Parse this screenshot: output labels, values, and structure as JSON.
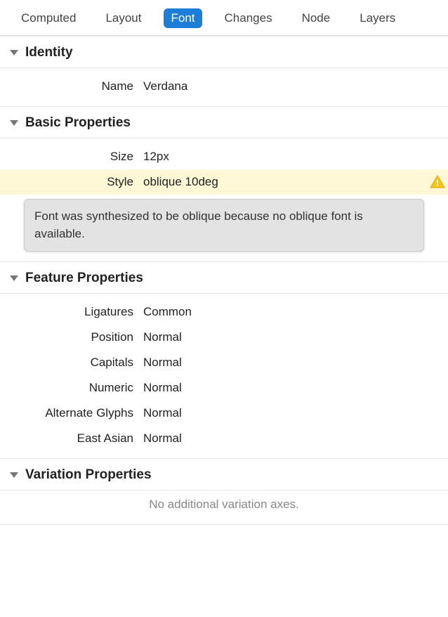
{
  "tabs": {
    "computed": "Computed",
    "layout": "Layout",
    "font": "Font",
    "changes": "Changes",
    "node": "Node",
    "layers": "Layers",
    "active": "font"
  },
  "sections": {
    "identity": {
      "title": "Identity",
      "props": {
        "name": {
          "label": "Name",
          "value": "Verdana"
        }
      }
    },
    "basic": {
      "title": "Basic Properties",
      "props": {
        "size": {
          "label": "Size",
          "value": "12px"
        },
        "style": {
          "label": "Style",
          "value": "oblique 10deg",
          "warning": true
        }
      },
      "warning_message": "Font was synthesized to be oblique because no oblique font is available."
    },
    "feature": {
      "title": "Feature Properties",
      "props": {
        "ligatures": {
          "label": "Ligatures",
          "value": "Common"
        },
        "position": {
          "label": "Position",
          "value": "Normal"
        },
        "capitals": {
          "label": "Capitals",
          "value": "Normal"
        },
        "numeric": {
          "label": "Numeric",
          "value": "Normal"
        },
        "alternate": {
          "label": "Alternate Glyphs",
          "value": "Normal"
        },
        "eastasian": {
          "label": "East Asian",
          "value": "Normal"
        }
      }
    },
    "variation": {
      "title": "Variation Properties",
      "empty": "No additional variation axes."
    }
  }
}
